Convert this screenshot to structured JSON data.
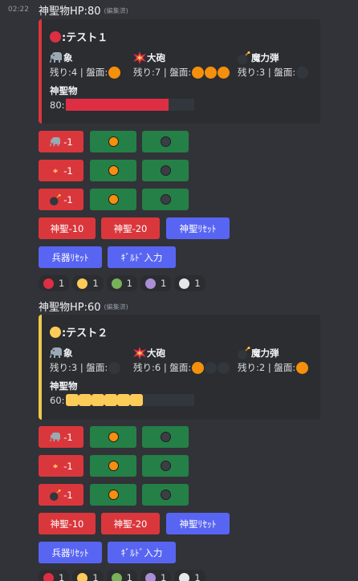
{
  "colors": {
    "red": "#dd2e44",
    "yellow": "#fdcb58",
    "green": "#78b159",
    "purple": "#aa8ed6",
    "white": "#e6e7e8",
    "orange": "#f4900c",
    "button_red": "#da373c",
    "button_green": "#248046",
    "button_blue": "#5865f2"
  },
  "messages": [
    {
      "timestamp": "02:22",
      "title": "神聖物HP:80",
      "edited": "(編集済)",
      "embed": {
        "accent": "red",
        "title_icon": "red-circle",
        "title": ":テスト１",
        "fields": [
          {
            "icon": "elephant-icon",
            "name": "象",
            "value": "残り:4 | 盤面:",
            "slots": [
              "on"
            ]
          },
          {
            "icon": "collision-icon",
            "name": "大砲",
            "value": "残り:7 | 盤面:",
            "slots": [
              "on",
              "on",
              "on"
            ]
          },
          {
            "icon": "bomb-icon",
            "name": "魔力弾",
            "value": "残り:3 | 盤面:",
            "slots": [
              "off"
            ]
          }
        ],
        "hp_label": "神聖物",
        "hp_value": "80:",
        "hp_filled": 8,
        "hp_total": 10
      },
      "buttons": {
        "row1": {
          "label": "-1",
          "icon": "elephant-icon"
        },
        "row2": {
          "label": "-1",
          "icon": "collision-icon"
        },
        "row3": {
          "label": "-1",
          "icon": "bomb-icon"
        },
        "minus10": "神聖-10",
        "minus20": "神聖-20",
        "reset_holy": "神聖ﾘｾｯﾄ",
        "reset_weapons": "兵器ﾘｾｯﾄ",
        "guild_input": "ｷﾞﾙﾄﾞ入力"
      },
      "reactions": [
        {
          "color": "red",
          "count": "1"
        },
        {
          "color": "yellow",
          "count": "1"
        },
        {
          "color": "green",
          "count": "1"
        },
        {
          "color": "purple",
          "count": "1"
        },
        {
          "color": "white",
          "count": "1"
        }
      ]
    },
    {
      "timestamp": "",
      "title": "神聖物HP:60",
      "edited": "(編集済)",
      "embed": {
        "accent": "yellow",
        "title_icon": "yellow-circle",
        "title": ":テスト２",
        "fields": [
          {
            "icon": "elephant-icon",
            "name": "象",
            "value": "残り:3 | 盤面:",
            "slots": [
              "off"
            ]
          },
          {
            "icon": "collision-icon",
            "name": "大砲",
            "value": "残り:6 | 盤面:",
            "slots": [
              "on",
              "off",
              "off"
            ]
          },
          {
            "icon": "bomb-icon",
            "name": "魔力弾",
            "value": "残り:2 | 盤面:",
            "slots": [
              "on"
            ]
          }
        ],
        "hp_label": "神聖物",
        "hp_value": "60:",
        "hp_filled": 6,
        "hp_total": 10
      },
      "buttons": {
        "row1": {
          "label": "-1",
          "icon": "elephant-icon"
        },
        "row2": {
          "label": "-1",
          "icon": "collision-icon"
        },
        "row3": {
          "label": "-1",
          "icon": "bomb-icon"
        },
        "minus10": "神聖-10",
        "minus20": "神聖-20",
        "reset_holy": "神聖ﾘｾｯﾄ",
        "reset_weapons": "兵器ﾘｾｯﾄ",
        "guild_input": "ｷﾞﾙﾄﾞ入力"
      },
      "reactions": [
        {
          "color": "red",
          "count": "1"
        },
        {
          "color": "yellow",
          "count": "1"
        },
        {
          "color": "green",
          "count": "1"
        },
        {
          "color": "purple",
          "count": "1"
        },
        {
          "color": "white",
          "count": "1"
        }
      ]
    }
  ]
}
